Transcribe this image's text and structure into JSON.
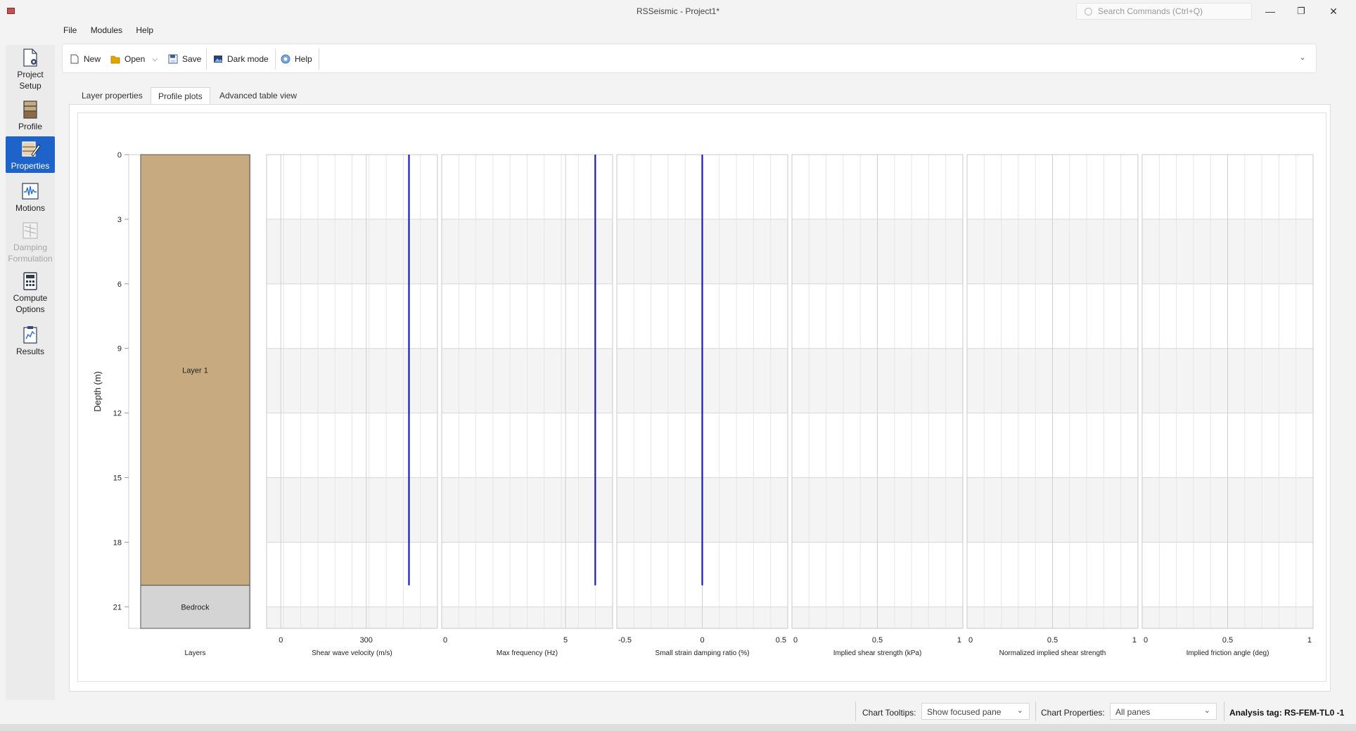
{
  "window": {
    "title": "RSSeismic - Project1*",
    "search_placeholder": "Search Commands (Ctrl+Q)",
    "minimize": "—",
    "restore": "❐",
    "close": "✕"
  },
  "menu": [
    "File",
    "Modules",
    "Help"
  ],
  "toolbar": {
    "new_label": "New",
    "open_label": "Open",
    "save_label": "Save",
    "dark_mode_label": "Dark mode",
    "help_label": "Help"
  },
  "rail": [
    {
      "label_line1": "Project",
      "label_line2": "Setup",
      "icon": "project-setup-icon",
      "state": "normal"
    },
    {
      "label_line1": "Profile",
      "label_line2": "",
      "icon": "profile-icon",
      "state": "normal"
    },
    {
      "label_line1": "Properties",
      "label_line2": "",
      "icon": "properties-icon",
      "state": "active"
    },
    {
      "label_line1": "Motions",
      "label_line2": "",
      "icon": "motions-icon",
      "state": "normal"
    },
    {
      "label_line1": "Damping",
      "label_line2": "Formulation",
      "icon": "damping-icon",
      "state": "disabled"
    },
    {
      "label_line1": "Compute",
      "label_line2": "Options",
      "icon": "compute-icon",
      "state": "normal"
    },
    {
      "label_line1": "Results",
      "label_line2": "",
      "icon": "results-icon",
      "state": "normal"
    }
  ],
  "tabs": [
    {
      "label": "Layer properties",
      "active": false
    },
    {
      "label": "Profile plots",
      "active": true
    },
    {
      "label": "Advanced table view",
      "active": false
    }
  ],
  "chart_data": {
    "type": "line",
    "ylabel": "Depth (m)",
    "y_ticks": [
      "0",
      "3",
      "6",
      "9",
      "12",
      "15",
      "18",
      "21"
    ],
    "ylim": [
      0,
      22
    ],
    "y_reversed": true,
    "layers": [
      {
        "name": "Layer 1",
        "top": 0,
        "bottom": 20,
        "color": "#c8aa80"
      },
      {
        "name": "Bedrock",
        "top": 20,
        "bottom": 22,
        "color": "#d4d4d4"
      }
    ],
    "layers_label": "Layers",
    "line_color": "#1a1ab8",
    "panes": [
      {
        "xlabel": "Shear wave velocity (m/s)",
        "ticks": [
          "0",
          "300"
        ],
        "tick_values": [
          0,
          300
        ],
        "xlim": [
          -50,
          550
        ],
        "line_x": 450,
        "line_depth": [
          0,
          20
        ]
      },
      {
        "xlabel": "Max frequency (Hz)",
        "ticks": [
          "0",
          "5"
        ],
        "tick_values": [
          0,
          5
        ],
        "xlim": [
          0,
          6.9
        ],
        "line_x": 6.2,
        "line_depth": [
          0,
          20
        ]
      },
      {
        "xlabel": "Small strain damping ratio (%)",
        "ticks": [
          "-0.5",
          "0",
          "0.5"
        ],
        "tick_values": [
          -0.5,
          0,
          0.5
        ],
        "xlim": [
          -0.5,
          0.5
        ],
        "line_x": 0,
        "line_depth": [
          0,
          20
        ]
      },
      {
        "xlabel": "Implied shear strength (kPa)",
        "ticks": [
          "0",
          "0.5",
          "1"
        ],
        "tick_values": [
          0,
          0.5,
          1
        ],
        "xlim": [
          0,
          1
        ],
        "line_x": null,
        "line_depth": null
      },
      {
        "xlabel": "Normalized implied shear strength",
        "ticks": [
          "0",
          "0.5",
          "1"
        ],
        "tick_values": [
          0,
          0.5,
          1
        ],
        "xlim": [
          0,
          1
        ],
        "line_x": null,
        "line_depth": null
      },
      {
        "xlabel": "Implied friction angle (deg)",
        "ticks": [
          "0",
          "0.5",
          "1"
        ],
        "tick_values": [
          0,
          0.5,
          1
        ],
        "xlim": [
          0,
          1
        ],
        "line_x": null,
        "line_depth": null
      }
    ]
  },
  "status": {
    "tooltips_label": "Chart Tooltips:",
    "tooltips_value": "Show focused pane",
    "properties_label": "Chart Properties:",
    "properties_value": "All panes",
    "analysis_tag": "Analysis tag: RS-FEM-TL0 -1"
  }
}
